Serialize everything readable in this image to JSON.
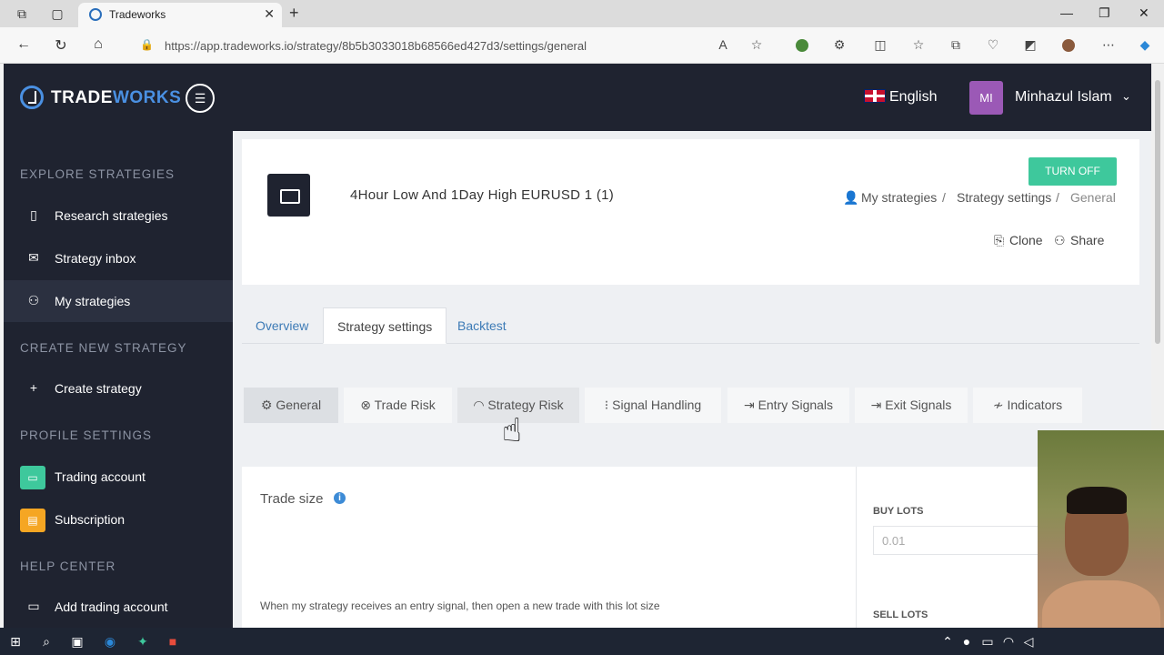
{
  "browser": {
    "tab_title": "Tradeworks",
    "url": "https://app.tradeworks.io/strategy/8b5b3033018b68566ed427d3/settings/general"
  },
  "brand": {
    "part1": "TRADE",
    "part2": "WORKS"
  },
  "header": {
    "language": "English",
    "avatar_initials": "MI",
    "user_name": "Minhazul Islam"
  },
  "sidebar": {
    "sections": [
      {
        "title": "EXPLORE STRATEGIES"
      },
      {
        "title": "CREATE NEW STRATEGY"
      },
      {
        "title": "PROFILE SETTINGS"
      },
      {
        "title": "HELP CENTER"
      }
    ],
    "items": [
      {
        "label": "Research strategies",
        "icon": "book-icon"
      },
      {
        "label": "Strategy inbox",
        "icon": "inbox-icon"
      },
      {
        "label": "My strategies",
        "icon": "user-icon",
        "active": true
      },
      {
        "label": "Create strategy",
        "icon": "plus-icon"
      },
      {
        "label": "Trading account",
        "icon": "wallet-icon",
        "color": "#3ec89c"
      },
      {
        "label": "Subscription",
        "icon": "cart-icon",
        "color": "#f5a623"
      },
      {
        "label": "Add trading account",
        "icon": "wallet-icon"
      }
    ]
  },
  "strategy": {
    "title": "4Hour Low And 1Day High EURUSD 1 (1)",
    "turn_off": "TURN OFF",
    "breadcrumb": [
      "My strategies",
      "Strategy settings",
      "General"
    ],
    "breadcrumb_sep": "/",
    "clone": "Clone",
    "share": "Share"
  },
  "page_tabs": [
    {
      "label": "Overview"
    },
    {
      "label": "Strategy settings",
      "active": true
    },
    {
      "label": "Backtest"
    }
  ],
  "settings_tabs": [
    {
      "label": "General",
      "active": true
    },
    {
      "label": "Trade Risk"
    },
    {
      "label": "Strategy Risk"
    },
    {
      "label": "Signal Handling"
    },
    {
      "label": "Entry Signals"
    },
    {
      "label": "Exit Signals"
    },
    {
      "label": "Indicators"
    }
  ],
  "trade_size": {
    "title": "Trade size",
    "description": "When my strategy receives an entry signal, then open a new trade with this lot size",
    "buy_lots_label": "BUY LOTS",
    "buy_lots_placeholder": "0.01",
    "sell_lots_label": "SELL LOTS"
  },
  "colors": {
    "nav_bg": "#1f2330",
    "accent_blue": "#4a90e2",
    "turn_off_green": "#3ec89c",
    "avatar_purple": "#9b59b6"
  }
}
